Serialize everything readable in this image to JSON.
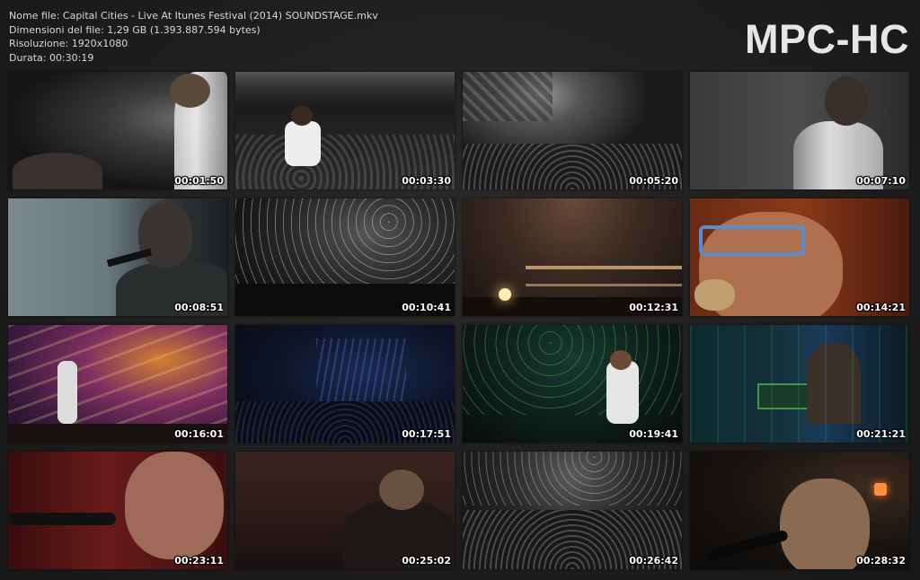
{
  "file_info": {
    "name": "Nome file: Capital Cities - Live At Itunes Festival (2014) SOUNDSTAGE.mkv",
    "size": "Dimensioni del file: 1,29 GB (1.393.887.594 bytes)",
    "resolution": "Risoluzione: 1920x1080",
    "duration": "Durata: 00:30:19"
  },
  "logo": "MPC-HC",
  "thumbnails": [
    {
      "time": "00:01:50"
    },
    {
      "time": "00:03:30"
    },
    {
      "time": "00:05:20"
    },
    {
      "time": "00:07:10"
    },
    {
      "time": "00:08:51"
    },
    {
      "time": "00:10:41"
    },
    {
      "time": "00:12:31"
    },
    {
      "time": "00:14:21"
    },
    {
      "time": "00:16:01"
    },
    {
      "time": "00:17:51"
    },
    {
      "time": "00:19:41"
    },
    {
      "time": "00:21:21"
    },
    {
      "time": "00:23:11"
    },
    {
      "time": "00:25:02"
    },
    {
      "time": "00:26:42"
    },
    {
      "time": "00:28:32"
    }
  ],
  "colors": {
    "background": "#1e1e1e",
    "text": "#d8d8d8",
    "logo": "#e6e6e6"
  }
}
